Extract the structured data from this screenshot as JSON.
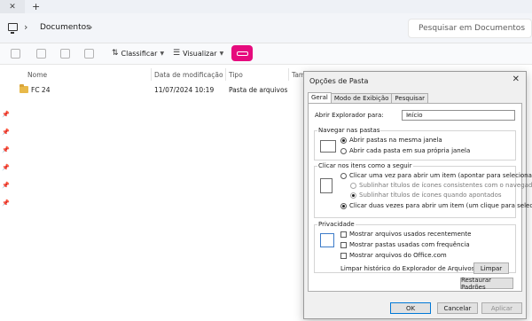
{
  "tabstrip": {
    "close_glyph": "✕",
    "new_tab_glyph": "+"
  },
  "address": {
    "folder": "Documentos",
    "search_placeholder": "Pesquisar em Documentos"
  },
  "commandbar": {
    "sort_label": "Classificar",
    "view_label": "Visualizar",
    "sort_icon": "sort-icon",
    "view_icon": "view-icon"
  },
  "filelist": {
    "columns": {
      "name": "Nome",
      "modified": "Data de modificação",
      "type": "Tipo",
      "size": "Tam"
    },
    "rows": [
      {
        "name": "FC 24",
        "modified": "11/07/2024 10:19",
        "type": "Pasta de arquivos"
      }
    ]
  },
  "dialog": {
    "title": "Opções de Pasta",
    "close_glyph": "✕",
    "tabs": [
      "Geral",
      "Modo de Exibição",
      "Pesquisar"
    ],
    "open_explorer_label": "Abrir Explorador para:",
    "open_explorer_value": "Início",
    "browse_group": {
      "title": "Navegar nas pastas",
      "opt_same": "Abrir pastas na mesma janela",
      "opt_own": "Abrir cada pasta em sua própria janela"
    },
    "click_group": {
      "title": "Clicar nos itens como a seguir",
      "opt_single": "Clicar uma vez para abrir um item (apontar para selecionar)",
      "sub_consistent": "Sublinhar títulos de ícones consistentes com o navegador",
      "sub_point": "Sublinhar títulos de ícones quando apontados",
      "opt_double": "Clicar duas vezes para abrir um item (um clique para selecionar)"
    },
    "privacy_group": {
      "title": "Privacidade",
      "chk_files": "Mostrar arquivos usados recentemente",
      "chk_folders": "Mostrar pastas usadas com frequência",
      "chk_office": "Mostrar arquivos do Office.com",
      "clear_label": "Limpar histórico do Explorador de Arquivos",
      "clear_button": "Limpar"
    },
    "restore_button": "Restaurar Padrões",
    "ok_button": "OK",
    "cancel_button": "Cancelar",
    "apply_button": "Aplicar"
  }
}
